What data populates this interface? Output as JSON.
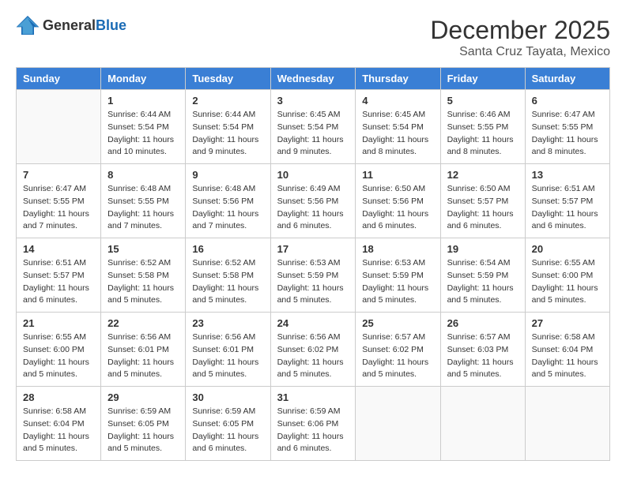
{
  "logo": {
    "text_general": "General",
    "text_blue": "Blue"
  },
  "title": "December 2025",
  "location": "Santa Cruz Tayata, Mexico",
  "days_of_week": [
    "Sunday",
    "Monday",
    "Tuesday",
    "Wednesday",
    "Thursday",
    "Friday",
    "Saturday"
  ],
  "weeks": [
    [
      {
        "day": "",
        "info": ""
      },
      {
        "day": "1",
        "info": "Sunrise: 6:44 AM\nSunset: 5:54 PM\nDaylight: 11 hours\nand 10 minutes."
      },
      {
        "day": "2",
        "info": "Sunrise: 6:44 AM\nSunset: 5:54 PM\nDaylight: 11 hours\nand 9 minutes."
      },
      {
        "day": "3",
        "info": "Sunrise: 6:45 AM\nSunset: 5:54 PM\nDaylight: 11 hours\nand 9 minutes."
      },
      {
        "day": "4",
        "info": "Sunrise: 6:45 AM\nSunset: 5:54 PM\nDaylight: 11 hours\nand 8 minutes."
      },
      {
        "day": "5",
        "info": "Sunrise: 6:46 AM\nSunset: 5:55 PM\nDaylight: 11 hours\nand 8 minutes."
      },
      {
        "day": "6",
        "info": "Sunrise: 6:47 AM\nSunset: 5:55 PM\nDaylight: 11 hours\nand 8 minutes."
      }
    ],
    [
      {
        "day": "7",
        "info": "Sunrise: 6:47 AM\nSunset: 5:55 PM\nDaylight: 11 hours\nand 7 minutes."
      },
      {
        "day": "8",
        "info": "Sunrise: 6:48 AM\nSunset: 5:55 PM\nDaylight: 11 hours\nand 7 minutes."
      },
      {
        "day": "9",
        "info": "Sunrise: 6:48 AM\nSunset: 5:56 PM\nDaylight: 11 hours\nand 7 minutes."
      },
      {
        "day": "10",
        "info": "Sunrise: 6:49 AM\nSunset: 5:56 PM\nDaylight: 11 hours\nand 6 minutes."
      },
      {
        "day": "11",
        "info": "Sunrise: 6:50 AM\nSunset: 5:56 PM\nDaylight: 11 hours\nand 6 minutes."
      },
      {
        "day": "12",
        "info": "Sunrise: 6:50 AM\nSunset: 5:57 PM\nDaylight: 11 hours\nand 6 minutes."
      },
      {
        "day": "13",
        "info": "Sunrise: 6:51 AM\nSunset: 5:57 PM\nDaylight: 11 hours\nand 6 minutes."
      }
    ],
    [
      {
        "day": "14",
        "info": "Sunrise: 6:51 AM\nSunset: 5:57 PM\nDaylight: 11 hours\nand 6 minutes."
      },
      {
        "day": "15",
        "info": "Sunrise: 6:52 AM\nSunset: 5:58 PM\nDaylight: 11 hours\nand 5 minutes."
      },
      {
        "day": "16",
        "info": "Sunrise: 6:52 AM\nSunset: 5:58 PM\nDaylight: 11 hours\nand 5 minutes."
      },
      {
        "day": "17",
        "info": "Sunrise: 6:53 AM\nSunset: 5:59 PM\nDaylight: 11 hours\nand 5 minutes."
      },
      {
        "day": "18",
        "info": "Sunrise: 6:53 AM\nSunset: 5:59 PM\nDaylight: 11 hours\nand 5 minutes."
      },
      {
        "day": "19",
        "info": "Sunrise: 6:54 AM\nSunset: 5:59 PM\nDaylight: 11 hours\nand 5 minutes."
      },
      {
        "day": "20",
        "info": "Sunrise: 6:55 AM\nSunset: 6:00 PM\nDaylight: 11 hours\nand 5 minutes."
      }
    ],
    [
      {
        "day": "21",
        "info": "Sunrise: 6:55 AM\nSunset: 6:00 PM\nDaylight: 11 hours\nand 5 minutes."
      },
      {
        "day": "22",
        "info": "Sunrise: 6:56 AM\nSunset: 6:01 PM\nDaylight: 11 hours\nand 5 minutes."
      },
      {
        "day": "23",
        "info": "Sunrise: 6:56 AM\nSunset: 6:01 PM\nDaylight: 11 hours\nand 5 minutes."
      },
      {
        "day": "24",
        "info": "Sunrise: 6:56 AM\nSunset: 6:02 PM\nDaylight: 11 hours\nand 5 minutes."
      },
      {
        "day": "25",
        "info": "Sunrise: 6:57 AM\nSunset: 6:02 PM\nDaylight: 11 hours\nand 5 minutes."
      },
      {
        "day": "26",
        "info": "Sunrise: 6:57 AM\nSunset: 6:03 PM\nDaylight: 11 hours\nand 5 minutes."
      },
      {
        "day": "27",
        "info": "Sunrise: 6:58 AM\nSunset: 6:04 PM\nDaylight: 11 hours\nand 5 minutes."
      }
    ],
    [
      {
        "day": "28",
        "info": "Sunrise: 6:58 AM\nSunset: 6:04 PM\nDaylight: 11 hours\nand 5 minutes."
      },
      {
        "day": "29",
        "info": "Sunrise: 6:59 AM\nSunset: 6:05 PM\nDaylight: 11 hours\nand 5 minutes."
      },
      {
        "day": "30",
        "info": "Sunrise: 6:59 AM\nSunset: 6:05 PM\nDaylight: 11 hours\nand 6 minutes."
      },
      {
        "day": "31",
        "info": "Sunrise: 6:59 AM\nSunset: 6:06 PM\nDaylight: 11 hours\nand 6 minutes."
      },
      {
        "day": "",
        "info": ""
      },
      {
        "day": "",
        "info": ""
      },
      {
        "day": "",
        "info": ""
      }
    ]
  ]
}
